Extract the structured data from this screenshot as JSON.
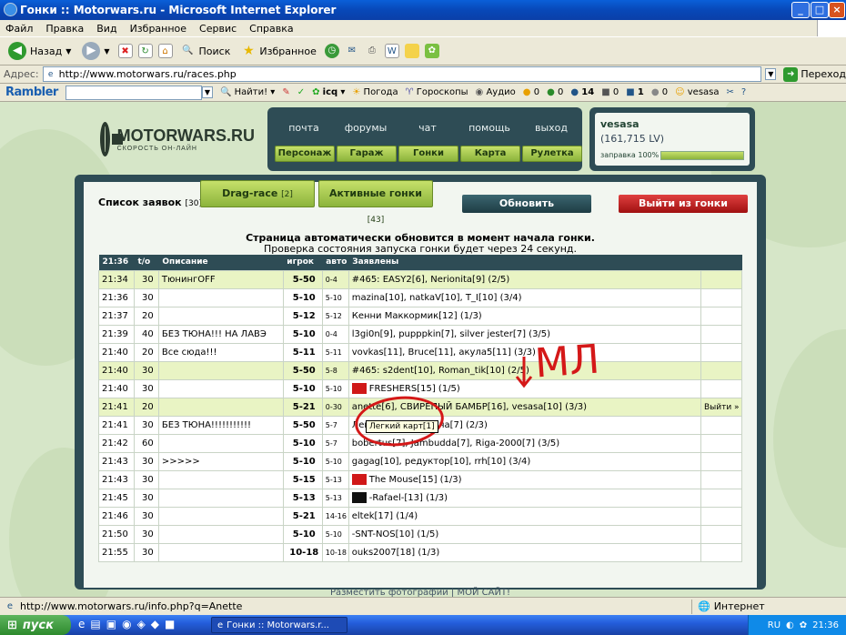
{
  "window": {
    "title": "Гонки :: Motorwars.ru - Microsoft Internet Explorer",
    "controls": [
      "minimize-icon",
      "maximize-icon",
      "close-icon"
    ]
  },
  "menu": [
    "Файл",
    "Правка",
    "Вид",
    "Избранное",
    "Сервис",
    "Справка"
  ],
  "toolbar": {
    "back": "Назад",
    "search": "Поиск",
    "favorites": "Избранное"
  },
  "address": {
    "label": "Адрес:",
    "url": "http://www.motorwars.ru/races.php",
    "go": "Переход"
  },
  "rambler": {
    "logo": "Rambler",
    "find": "Найти!",
    "icq": "icq",
    "weather": "Погода",
    "horoscope": "Гороскопы",
    "audio": "Аудио",
    "counters": [
      "0",
      "0",
      "14",
      "0",
      "1",
      "0"
    ],
    "user": "vesasa"
  },
  "site": {
    "logo_name": "MOTORWARS.RU",
    "logo_sub": "СКОРОСТЬ ОН-ЛАЙН",
    "nav_top": [
      "почта",
      "форумы",
      "чат",
      "помощь",
      "выход"
    ],
    "nav_green": [
      "Персонаж",
      "Гараж",
      "Гонки",
      "Карта",
      "Рулетка"
    ],
    "user": {
      "name": "vesasa",
      "balance": "(161,715 LV)",
      "fuel_label": "заправка 100%",
      "fuel_level": 1.0
    },
    "tabs": {
      "list_label": "Список заявок",
      "list_count": "[30]",
      "drag_label": "Drag-race",
      "drag_count": "[2]",
      "active_label": "Активные гонки",
      "active_count": "[43]"
    },
    "buttons": {
      "refresh": "Обновить",
      "exit_race": "Выйти из гонки"
    },
    "notice_line1": "Страница автоматически обновится в момент начала гонки.",
    "notice_line2": "Проверка состояния запуска гонки будет через 24 секунд.",
    "table": {
      "headers": [
        "21:36",
        "t/o",
        "Описание",
        "игрок",
        "авто",
        "Заявлены",
        ""
      ],
      "rows": [
        {
          "time": "21:34",
          "to": "30",
          "desc": "ТюнингOFF",
          "players": "5-50",
          "auto": "0-4",
          "declared": "#465: EASY2[6],  Nerionita[9] (2/5)",
          "action": "",
          "hl": true,
          "flag": ""
        },
        {
          "time": "21:36",
          "to": "30",
          "desc": "",
          "players": "5-10",
          "auto": "5-10",
          "declared": "mazina[10],  natkaV[10],  T_I[10] (3/4)",
          "action": "",
          "hl": false,
          "flag": ""
        },
        {
          "time": "21:37",
          "to": "20",
          "desc": "",
          "players": "5-12",
          "auto": "5-12",
          "declared": "Кенни Маккормик[12] (1/3)",
          "action": "",
          "hl": false,
          "flag": ""
        },
        {
          "time": "21:39",
          "to": "40",
          "desc": "БЕЗ ТЮНА!!! НА ЛАВЭ",
          "players": "5-10",
          "auto": "0-4",
          "declared": "l3gi0n[9],  pupppkin[7],  silver jester[7] (3/5)",
          "action": "",
          "hl": false,
          "flag": ""
        },
        {
          "time": "21:40",
          "to": "20",
          "desc": "Все сюда!!!",
          "players": "5-11",
          "auto": "5-11",
          "declared": "vovkas[11],  Bruce[11],  акула5[11] (3/3)",
          "action": "",
          "hl": false,
          "flag": ""
        },
        {
          "time": "21:40",
          "to": "30",
          "desc": "",
          "players": "5-50",
          "auto": "5-8",
          "declared": "#465: s2dent[10],  Roman_tik[10] (2/5)",
          "action": "",
          "hl": true,
          "flag": ""
        },
        {
          "time": "21:40",
          "to": "30",
          "desc": "",
          "players": "5-10",
          "auto": "5-10",
          "declared": "FRESHERS[15] (1/5)",
          "action": "",
          "hl": false,
          "flag": "red"
        },
        {
          "time": "21:41",
          "to": "20",
          "desc": "",
          "players": "5-21",
          "auto": "0-30",
          "declared": "anette[6],  СВИРЕПЫЙ БАМБР[16],  vesasa[10] (3/3)",
          "action": "Выйти »",
          "hl": true,
          "flag": ""
        },
        {
          "time": "21:41",
          "to": "30",
          "desc": "БЕЗ ТЮНА!!!!!!!!!!!",
          "players": "5-50",
          "auto": "5-7",
          "declared": "Легкий карт[1] Куча[7] (2/3)",
          "action": "",
          "hl": false,
          "flag": ""
        },
        {
          "time": "21:42",
          "to": "60",
          "desc": "",
          "players": "5-10",
          "auto": "5-7",
          "declared": "bobertus[7],  Jambudda[7],  Riga-2000[7] (3/5)",
          "action": "",
          "hl": false,
          "flag": ""
        },
        {
          "time": "21:43",
          "to": "30",
          "desc": ">>>>>",
          "players": "5-10",
          "auto": "5-10",
          "declared": "gagag[10],  редуктор[10],  rrh[10] (3/4)",
          "action": "",
          "hl": false,
          "flag": ""
        },
        {
          "time": "21:43",
          "to": "30",
          "desc": "",
          "players": "5-15",
          "auto": "5-13",
          "declared": "The Mouse[15] (1/3)",
          "action": "",
          "hl": false,
          "flag": "red"
        },
        {
          "time": "21:45",
          "to": "30",
          "desc": "",
          "players": "5-13",
          "auto": "5-13",
          "declared": "-Rafael-[13] (1/3)",
          "action": "",
          "hl": false,
          "flag": "black"
        },
        {
          "time": "21:46",
          "to": "30",
          "desc": "",
          "players": "5-21",
          "auto": "14-16",
          "declared": "eltek[17] (1/4)",
          "action": "",
          "hl": false,
          "flag": ""
        },
        {
          "time": "21:50",
          "to": "30",
          "desc": "",
          "players": "5-10",
          "auto": "5-10",
          "declared": "-SNT-NOS[10] (1/5)",
          "action": "",
          "hl": false,
          "flag": ""
        },
        {
          "time": "21:55",
          "to": "30",
          "desc": "",
          "players": "10-18",
          "auto": "10-18",
          "declared": "ouks2007[18] (1/3)",
          "action": "",
          "hl": false,
          "flag": ""
        }
      ]
    },
    "footer_link": "Разместить фотографии | МОЙ САЙТ!",
    "tooltip": "Легкий карт[1]",
    "annotation": "МЛ"
  },
  "status": {
    "url": "http://www.motorwars.ru/info.php?q=Anette",
    "zone": "Интернет"
  },
  "taskbar": {
    "start": "пуск",
    "task": "Гонки :: Motorwars.r...",
    "lang": "RU",
    "clock": "21:36"
  }
}
